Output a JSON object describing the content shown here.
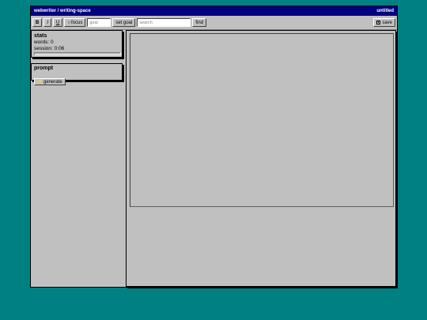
{
  "window": {
    "title": "webwriter / writing-space",
    "doc_name": "untitled"
  },
  "toolbar": {
    "bold_label": "B",
    "italic_label": "I",
    "underline_label": "U",
    "focus_label": "focus",
    "goal_placeholder": "goal",
    "set_goal_label": "set goal",
    "search_placeholder": "search",
    "find_label": "find",
    "save_label": "save"
  },
  "stats": {
    "title": "stats",
    "words_label": "words: 0",
    "session_label": "session: 0:06",
    "progress": 0
  },
  "prompt": {
    "title": "prompt",
    "generate_label": "generate"
  },
  "editor": {
    "value": ""
  },
  "colors": {
    "desktop": "#008080",
    "titlebar": "#000080",
    "face": "#c0c0c0"
  }
}
